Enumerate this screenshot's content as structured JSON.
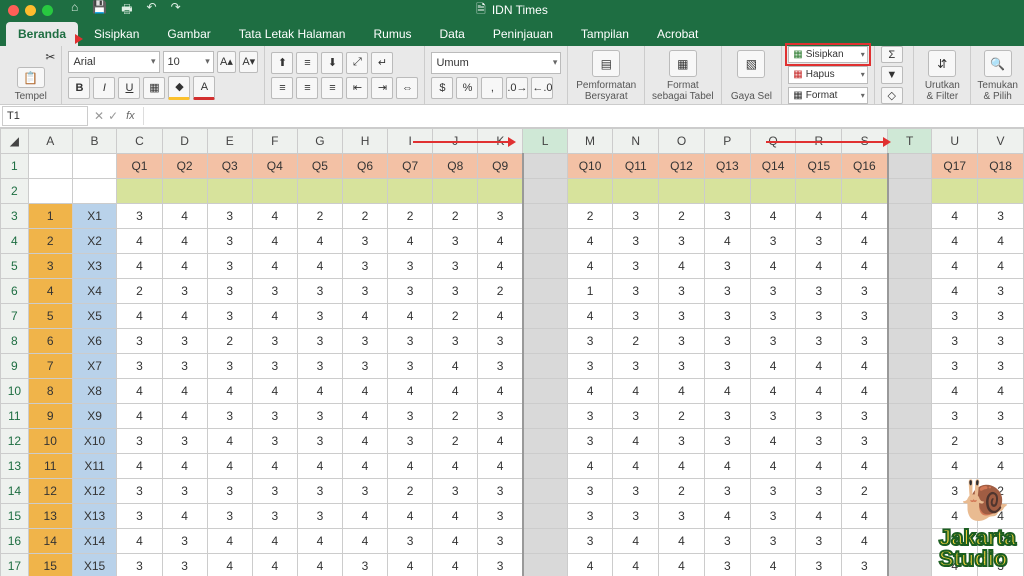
{
  "window": {
    "title": "IDN Times"
  },
  "tabs": [
    "Beranda",
    "Sisipkan",
    "Gambar",
    "Tata Letak Halaman",
    "Rumus",
    "Data",
    "Peninjauan",
    "Tampilan",
    "Acrobat"
  ],
  "ribbon": {
    "paste_label": "Tempel",
    "font_name": "Arial",
    "font_size": "10",
    "number_format": "Umum",
    "cond_fmt": "Pemformatan Bersyarat",
    "as_table": "Format sebagai Tabel",
    "cell_styles": "Gaya Sel",
    "insert": "Sisipkan",
    "delete": "Hapus",
    "format": "Format",
    "sort_filter": "Urutkan & Filter",
    "find": "Temukan & Pilih"
  },
  "namebox": "T1",
  "columns": [
    "A",
    "B",
    "C",
    "D",
    "E",
    "F",
    "G",
    "H",
    "I",
    "J",
    "K",
    "L",
    "M",
    "N",
    "O",
    "P",
    "Q",
    "R",
    "S",
    "T",
    "U",
    "V"
  ],
  "qheaders_left": [
    "Q1",
    "Q2",
    "Q3",
    "Q4",
    "Q5",
    "Q6",
    "Q7",
    "Q8",
    "Q9"
  ],
  "qheaders_mid": [
    "Q10",
    "Q11",
    "Q12",
    "Q13",
    "Q14",
    "Q15",
    "Q16"
  ],
  "qheaders_right": [
    "Q17",
    "Q18"
  ],
  "rows": [
    {
      "n": "1",
      "x": "X1",
      "l": [
        "3",
        "4",
        "3",
        "4",
        "2",
        "2",
        "2",
        "2",
        "3"
      ],
      "m": [
        "2",
        "3",
        "2",
        "3",
        "4",
        "4",
        "4"
      ],
      "r": [
        "4",
        "3"
      ]
    },
    {
      "n": "2",
      "x": "X2",
      "l": [
        "4",
        "4",
        "3",
        "4",
        "4",
        "3",
        "4",
        "3",
        "4"
      ],
      "m": [
        "4",
        "3",
        "3",
        "4",
        "3",
        "3",
        "4"
      ],
      "r": [
        "4",
        "4"
      ]
    },
    {
      "n": "3",
      "x": "X3",
      "l": [
        "4",
        "4",
        "3",
        "4",
        "4",
        "3",
        "3",
        "3",
        "4"
      ],
      "m": [
        "4",
        "3",
        "4",
        "3",
        "4",
        "4",
        "4"
      ],
      "r": [
        "4",
        "4"
      ]
    },
    {
      "n": "4",
      "x": "X4",
      "l": [
        "2",
        "3",
        "3",
        "3",
        "3",
        "3",
        "3",
        "3",
        "2"
      ],
      "m": [
        "1",
        "3",
        "3",
        "3",
        "3",
        "3",
        "3"
      ],
      "r": [
        "4",
        "3"
      ]
    },
    {
      "n": "5",
      "x": "X5",
      "l": [
        "4",
        "4",
        "3",
        "4",
        "3",
        "4",
        "4",
        "2",
        "4"
      ],
      "m": [
        "4",
        "3",
        "3",
        "3",
        "3",
        "3",
        "3"
      ],
      "r": [
        "3",
        "3"
      ]
    },
    {
      "n": "6",
      "x": "X6",
      "l": [
        "3",
        "3",
        "2",
        "3",
        "3",
        "3",
        "3",
        "3",
        "3"
      ],
      "m": [
        "3",
        "2",
        "3",
        "3",
        "3",
        "3",
        "3"
      ],
      "r": [
        "3",
        "3"
      ]
    },
    {
      "n": "7",
      "x": "X7",
      "l": [
        "3",
        "3",
        "3",
        "3",
        "3",
        "3",
        "3",
        "4",
        "3"
      ],
      "m": [
        "3",
        "3",
        "3",
        "3",
        "4",
        "4",
        "4"
      ],
      "r": [
        "3",
        "3"
      ]
    },
    {
      "n": "8",
      "x": "X8",
      "l": [
        "4",
        "4",
        "4",
        "4",
        "4",
        "4",
        "4",
        "4",
        "4"
      ],
      "m": [
        "4",
        "4",
        "4",
        "4",
        "4",
        "4",
        "4"
      ],
      "r": [
        "4",
        "4"
      ]
    },
    {
      "n": "9",
      "x": "X9",
      "l": [
        "4",
        "4",
        "3",
        "3",
        "3",
        "4",
        "3",
        "2",
        "3"
      ],
      "m": [
        "3",
        "3",
        "2",
        "3",
        "3",
        "3",
        "3"
      ],
      "r": [
        "3",
        "3"
      ]
    },
    {
      "n": "10",
      "x": "X10",
      "l": [
        "3",
        "3",
        "4",
        "3",
        "3",
        "4",
        "3",
        "2",
        "4"
      ],
      "m": [
        "3",
        "4",
        "3",
        "3",
        "4",
        "3",
        "3"
      ],
      "r": [
        "2",
        "3"
      ]
    },
    {
      "n": "11",
      "x": "X11",
      "l": [
        "4",
        "4",
        "4",
        "4",
        "4",
        "4",
        "4",
        "4",
        "4"
      ],
      "m": [
        "4",
        "4",
        "4",
        "4",
        "4",
        "4",
        "4"
      ],
      "r": [
        "4",
        "4"
      ]
    },
    {
      "n": "12",
      "x": "X12",
      "l": [
        "3",
        "3",
        "3",
        "3",
        "3",
        "3",
        "2",
        "3",
        "3"
      ],
      "m": [
        "3",
        "3",
        "2",
        "3",
        "3",
        "3",
        "2"
      ],
      "r": [
        "3",
        "2"
      ]
    },
    {
      "n": "13",
      "x": "X13",
      "l": [
        "3",
        "4",
        "3",
        "3",
        "3",
        "4",
        "4",
        "4",
        "3"
      ],
      "m": [
        "3",
        "3",
        "3",
        "4",
        "3",
        "4",
        "4"
      ],
      "r": [
        "4",
        "4"
      ]
    },
    {
      "n": "14",
      "x": "X14",
      "l": [
        "4",
        "3",
        "4",
        "4",
        "4",
        "4",
        "3",
        "4",
        "3"
      ],
      "m": [
        "3",
        "4",
        "4",
        "3",
        "3",
        "3",
        "4"
      ],
      "r": [
        "4",
        "3"
      ]
    },
    {
      "n": "15",
      "x": "X15",
      "l": [
        "3",
        "3",
        "4",
        "4",
        "4",
        "3",
        "4",
        "4",
        "3"
      ],
      "m": [
        "4",
        "4",
        "4",
        "3",
        "4",
        "3",
        "3"
      ],
      "r": [
        "4",
        "3"
      ]
    }
  ],
  "watermark": {
    "l1": "Jakarta",
    "l2": "Studio"
  }
}
